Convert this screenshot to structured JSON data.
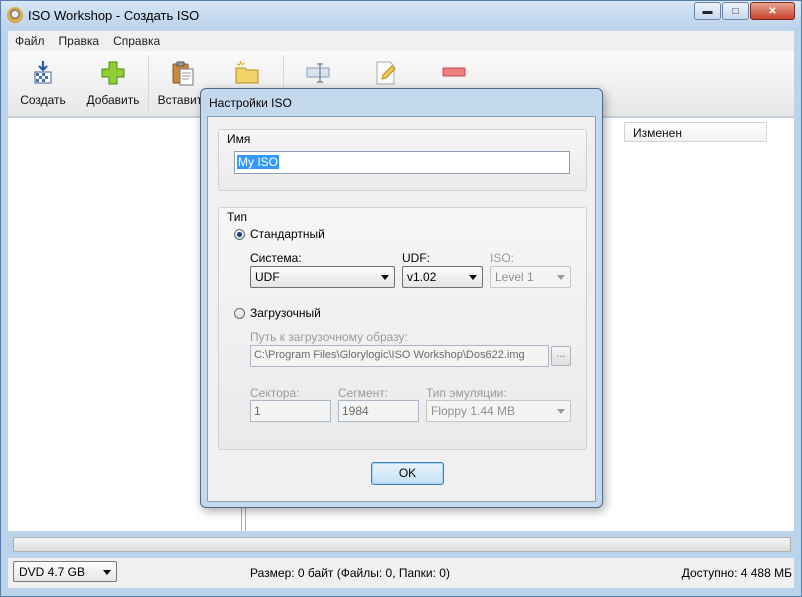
{
  "window": {
    "title": "ISO Workshop - Создать ISO"
  },
  "menu": [
    "Файл",
    "Правка",
    "Справка"
  ],
  "toolbar": {
    "create": "Создать",
    "add": "Добавить",
    "paste": "Вставить"
  },
  "list": {
    "col_modified": "Изменен"
  },
  "status": {
    "media": "DVD 4.7 GB",
    "size": "Размер: 0 байт (Файлы: 0, Папки: 0)",
    "free": "Доступно: 4 488 МБ"
  },
  "dialog": {
    "title": "Настройки ISO",
    "name_group": "Имя",
    "name_value": "My ISO",
    "type_group": "Тип",
    "standard_label": "Стандартный",
    "system_label": "Система:",
    "system_value": "UDF",
    "udf_label": "UDF:",
    "udf_value": "v1.02",
    "iso_label": "ISO:",
    "iso_value": "Level 1",
    "bootable_label": "Загрузочный",
    "boot_path_label": "Путь к загрузочному образу:",
    "boot_path_value": "C:\\Program Files\\Glorylogic\\ISO Workshop\\Dos622.img",
    "browse_label": "...",
    "sectors_label": "Сектора:",
    "sectors_value": "1",
    "segment_label": "Сегмент:",
    "segment_value": "1984",
    "emulation_label": "Тип эмуляции:",
    "emulation_value": "Floppy 1.44 MB",
    "ok": "OK",
    "selected_type": "standard"
  }
}
